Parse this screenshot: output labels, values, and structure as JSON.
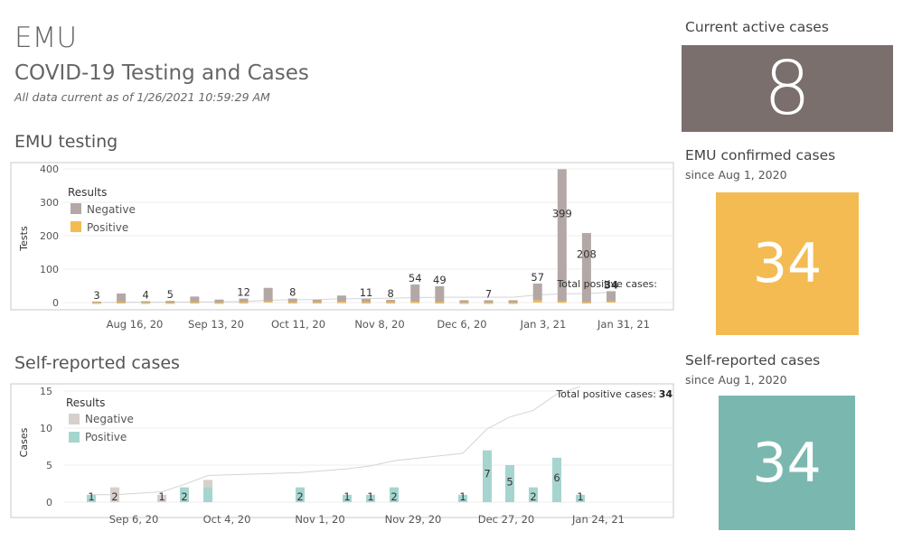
{
  "header": {
    "title": "EMU",
    "subtitle": "COVID-19 Testing  and Cases",
    "timestamp": "All data current as of 1/26/2021 10:59:29 AM"
  },
  "sections": {
    "testing_title": "EMU testing",
    "self_title": "Self-reported cases"
  },
  "kpis": {
    "active": {
      "label": "Current active cases",
      "value": "8",
      "color": "#7a6f6c"
    },
    "emu_confirmed": {
      "label": "EMU confirmed cases",
      "sublabel": "since Aug 1, 2020",
      "value": "34",
      "color": "#f3bb52"
    },
    "self_reported": {
      "label": "Self-reported cases",
      "sublabel": "since Aug 1, 2020",
      "value": "34",
      "color": "#7ab8af"
    }
  },
  "chart_data": [
    {
      "type": "bar",
      "ylabel": "Tests",
      "ylim": [
        0,
        420
      ],
      "yticks": [
        0,
        100,
        200,
        300,
        400
      ],
      "x_tick_labels": [
        "Aug 16, 20",
        "Sep 13, 20",
        "Oct 11, 20",
        "Nov 8, 20",
        "Dec 6, 20",
        "Jan 3, 21",
        "Jan 31, 21"
      ],
      "legend": {
        "title": "Results",
        "items": [
          {
            "name": "Negative",
            "color": "#b3a8a5"
          },
          {
            "name": "Positive",
            "color": "#f3bb52"
          }
        ]
      },
      "bar_totals": [
        3,
        27,
        4,
        5,
        18,
        9,
        12,
        44,
        12,
        8,
        21,
        11,
        8,
        54,
        49,
        7,
        7,
        7,
        57,
        399,
        208,
        34
      ],
      "positive": [
        0,
        1,
        0,
        0,
        1,
        0,
        1,
        4,
        1,
        1,
        2,
        1,
        1,
        2,
        1,
        0,
        0,
        0,
        7,
        3,
        1,
        4
      ],
      "data_labels": [
        "3",
        "",
        "4",
        "5",
        "",
        "",
        "12",
        "",
        "8",
        "",
        "",
        "11",
        "8",
        "54",
        "49",
        "",
        "7",
        "",
        "57",
        "399",
        "208",
        "34"
      ],
      "annotation": {
        "label": "Total positive cases:",
        "value": "34"
      },
      "cumulative_line": [
        0,
        1,
        1,
        1,
        2,
        2,
        3,
        7,
        8,
        9,
        11,
        12,
        13,
        15,
        16,
        16,
        16,
        16,
        23,
        26,
        27,
        31
      ]
    },
    {
      "type": "bar",
      "ylabel": "Cases",
      "ylim": [
        0,
        16
      ],
      "yticks": [
        0,
        5,
        10,
        15
      ],
      "x_tick_labels": [
        "Sep 6, 20",
        "Oct 4, 20",
        "Nov 1, 20",
        "Nov 29, 20",
        "Dec 27, 20",
        "Jan 24, 21"
      ],
      "legend": {
        "title": "Results",
        "items": [
          {
            "name": "Negative",
            "color": "#d6cfcc"
          },
          {
            "name": "Positive",
            "color": "#a6d5cf"
          }
        ]
      },
      "bar_positive": [
        1,
        0,
        0,
        2,
        2,
        2,
        1,
        1,
        2,
        1,
        7,
        5,
        2,
        6,
        1
      ],
      "bar_negative": [
        0,
        2,
        1,
        0,
        1,
        0,
        0,
        0,
        0,
        0,
        0,
        0,
        0,
        0,
        0
      ],
      "data_labels": [
        "1",
        "2",
        "1",
        "2",
        "",
        "2",
        "1",
        "1",
        "2",
        "1",
        "7",
        "5",
        "2",
        "6",
        "1"
      ],
      "annotation": {
        "label": "Total positive cases:",
        "value": "34"
      },
      "cumulative_line": [
        1,
        1,
        1.4,
        2.4,
        3.6,
        4,
        4.5,
        4.9,
        5.6,
        6.6,
        9.9,
        11.5,
        12.4,
        14.6,
        15.6
      ]
    }
  ]
}
